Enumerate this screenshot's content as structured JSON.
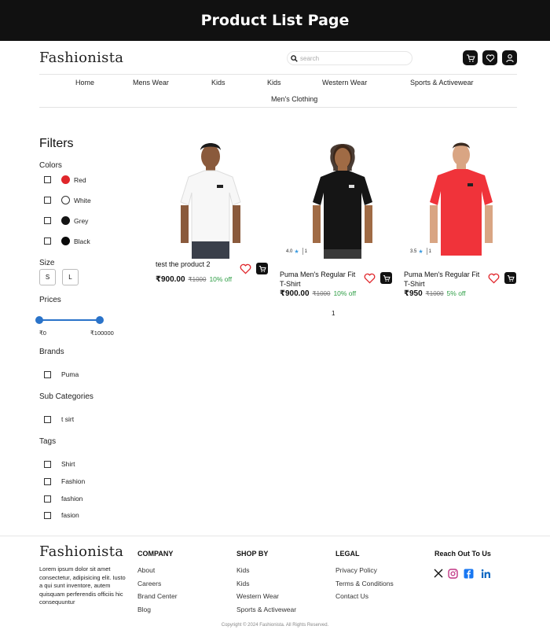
{
  "banner": {
    "title": "Product List Page"
  },
  "header": {
    "logo": "Fashionista",
    "search_placeholder": "search",
    "icons": [
      "cart-icon",
      "heart-icon",
      "user-icon"
    ]
  },
  "nav": {
    "items": [
      "Home",
      "Mens Wear",
      "Kids",
      "Kids",
      "Western Wear",
      "Sports & Activewear",
      "Men's Clothing"
    ]
  },
  "filters": {
    "title": "Filters",
    "colors_title": "Colors",
    "colors": [
      {
        "label": "Red",
        "hex": "#e0262b"
      },
      {
        "label": "White",
        "hex": "#ffffff"
      },
      {
        "label": "Grey",
        "hex": "#141414"
      },
      {
        "label": "Black",
        "hex": "#0a0a0a"
      }
    ],
    "size_title": "Size",
    "sizes": [
      "S",
      "L"
    ],
    "prices_title": "Prices",
    "price_min": "₹0",
    "price_max": "₹100000",
    "brands_title": "Brands",
    "brands": [
      "Puma"
    ],
    "subcategories_title": "Sub Categories",
    "subcategories": [
      "t sirt"
    ],
    "tags_title": "Tags",
    "tags": [
      "Shirt",
      "Fashion",
      "fashion",
      "fasion"
    ]
  },
  "products": [
    {
      "name": "test the product 2",
      "price": "₹900.00",
      "mrp": "₹1000",
      "off": "10% off",
      "shirt_color": "#f7f7f7"
    },
    {
      "name": "Puma Men's Regular Fit T-Shirt",
      "price": "₹900.00",
      "mrp": "₹1000",
      "off": "10% off",
      "rating": "4.0",
      "reviews": "1",
      "shirt_color": "#151515"
    },
    {
      "name": "Puma Men's Regular Fit T-Shirt",
      "price": "₹950",
      "mrp": "₹1000",
      "off": "5% off",
      "rating": "3.5",
      "reviews": "1",
      "shirt_color": "#f0333a"
    }
  ],
  "pagination": {
    "current": "1"
  },
  "footer": {
    "logo": "Fashionista",
    "description": "Lorem ipsum dolor sit amet consectetur, adipisicing elit. Iusto a qui sunt inventore, autem quisquam perferendis officiis hic consequuntur",
    "company": {
      "title": "COMPANY",
      "links": [
        "About",
        "Careers",
        "Brand Center",
        "Blog"
      ]
    },
    "shop_by": {
      "title": "SHOP BY",
      "links": [
        "Kids",
        "Kids",
        "Western Wear",
        "Sports & Activewear"
      ]
    },
    "legal": {
      "title": "LEGAL",
      "links": [
        "Privacy Policy",
        "Terms & Conditions",
        "Contact Us"
      ]
    },
    "reach": {
      "title": "Reach Out To Us",
      "icons": [
        "x-icon",
        "instagram-icon",
        "facebook-icon",
        "linkedin-icon"
      ]
    },
    "copyright": "Copyright © 2024 Fashionista. All Rights Reserved."
  }
}
